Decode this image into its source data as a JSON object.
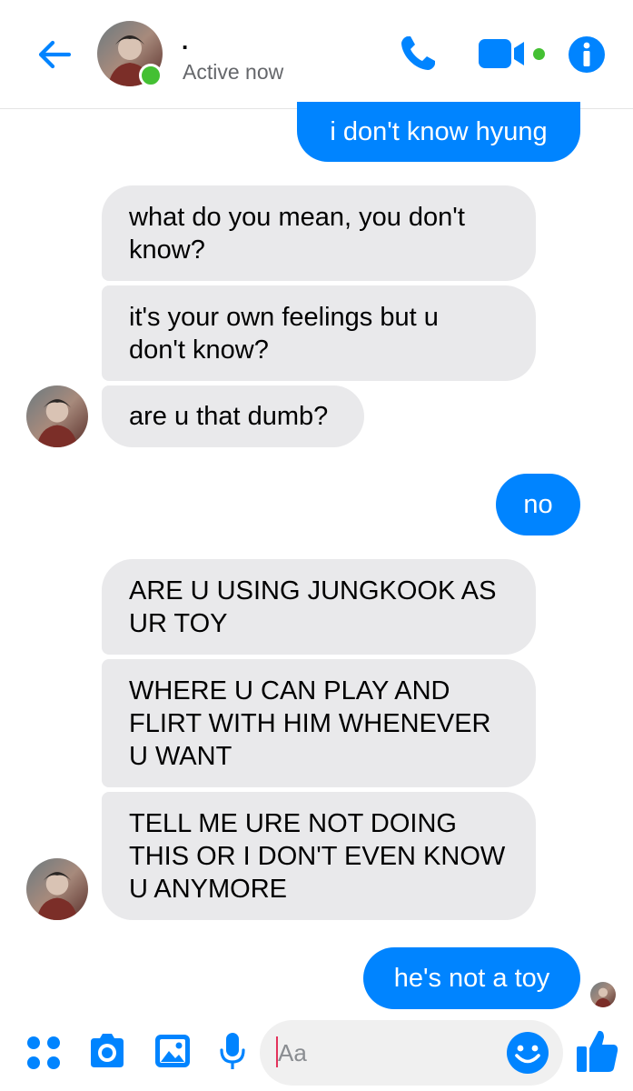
{
  "header": {
    "contact_name": ".",
    "status": "Active now"
  },
  "messages": [
    {
      "direction": "out",
      "text": "i don't know hyung"
    },
    {
      "direction": "in",
      "lines": [
        "what do you mean, you don't",
        "know?"
      ]
    },
    {
      "direction": "in",
      "lines": [
        "it's your own feelings but u",
        "don't know?"
      ]
    },
    {
      "direction": "in",
      "lines": [
        "are u that dumb?"
      ]
    },
    {
      "direction": "out",
      "text": "no"
    },
    {
      "direction": "in",
      "lines": [
        "ARE U USING JUNGKOOK AS",
        "UR TOY"
      ]
    },
    {
      "direction": "in",
      "lines": [
        "WHERE U CAN PLAY AND",
        "FLIRT WITH HIM WHENEVER",
        "U WANT"
      ]
    },
    {
      "direction": "in",
      "lines": [
        "TELL ME URE NOT DOING",
        "THIS OR I DON'T EVEN KNOW",
        "U ANYMORE"
      ]
    },
    {
      "direction": "out",
      "text": "he's not a toy"
    }
  ],
  "composer": {
    "placeholder": "Aa"
  },
  "colors": {
    "accent": "#0084ff",
    "presence": "#44c033",
    "incoming_bubble": "#e9e9eb"
  },
  "icons": [
    "back-arrow-icon",
    "phone-icon",
    "video-camera-icon",
    "info-icon",
    "apps-grid-icon",
    "camera-icon",
    "gallery-icon",
    "microphone-icon",
    "emoji-icon",
    "thumbs-up-icon"
  ]
}
